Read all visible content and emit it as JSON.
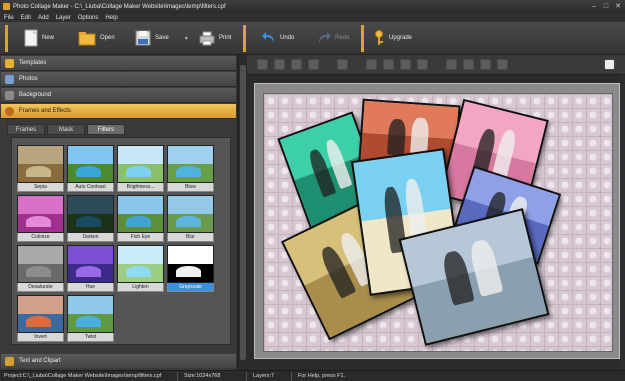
{
  "window": {
    "title": "Photo Collage Maker - C:\\_Liuba\\Collage Maker Website\\Images\\temp\\filters.cpf",
    "controls": [
      "minimize-icon",
      "maximize-icon",
      "close-icon"
    ]
  },
  "menu": [
    "File",
    "Edit",
    "Add",
    "Layer",
    "Options",
    "Help"
  ],
  "toolbar": {
    "new": "New",
    "open": "Open",
    "save": "Save",
    "print": "Print",
    "undo": "Undo",
    "redo": "Redo",
    "upgrade": "Upgrade"
  },
  "sidebar": {
    "templates": "Templates",
    "photos": "Photos",
    "background": "Background",
    "frames_effects": "Frames and Effects",
    "text_clipart": "Text and Clipart"
  },
  "tabs": [
    "Frames",
    "Mask",
    "Filters"
  ],
  "active_tab": "Filters",
  "filters": [
    {
      "label": "Sepia",
      "sky": "#b8a47e",
      "land": "#8a6b3e",
      "sea": "#c9b58a"
    },
    {
      "label": "Auto Contrast",
      "sky": "#7fc6f0",
      "land": "#4d8a2e",
      "sea": "#38a7d6"
    },
    {
      "label": "Brightness...",
      "sky": "#c7e7f8",
      "land": "#8bc06a",
      "sea": "#7dd0ee"
    },
    {
      "label": "Blow",
      "sky": "#9fd1ee",
      "land": "#6a9f4a",
      "sea": "#4fb3e0"
    },
    {
      "label": "Colorize",
      "sky": "#d870c8",
      "land": "#a02f8e",
      "sea": "#e48ad6"
    },
    {
      "label": "Darken",
      "sky": "#2d4a5a",
      "land": "#1c3318",
      "sea": "#1a4a60"
    },
    {
      "label": "Fish Eye",
      "sky": "#8cc6ea",
      "land": "#5d8e3a",
      "sea": "#3fa3d4"
    },
    {
      "label": "Blur",
      "sky": "#94c8e6",
      "land": "#6a9a4c",
      "sea": "#5db4de"
    },
    {
      "label": "Desaturate",
      "sky": "#a9a9a9",
      "land": "#6a6a6a",
      "sea": "#8c8c8c"
    },
    {
      "label": "Hue",
      "sky": "#7a4fd6",
      "land": "#3d2a8a",
      "sea": "#9a6ae6"
    },
    {
      "label": "Lighten",
      "sky": "#c9ecfb",
      "land": "#9ccd82",
      "sea": "#8fdaf3"
    },
    {
      "label": "Grayscale",
      "sky": "#ffffff",
      "land": "#000000",
      "sea": "#f0f0f0"
    },
    {
      "label": "Invert",
      "sky": "#d0a08a",
      "land": "#3a6aa0",
      "sea": "#e06a3a"
    },
    {
      "label": "Twist",
      "sky": "#8fc8e8",
      "land": "#5f9a42",
      "sea": "#4aaede"
    }
  ],
  "selected_filter": "Grayscale",
  "collage_photos": [
    {
      "tint_sky": "#3dd0a8",
      "tint_ground": "#1f8f72"
    },
    {
      "tint_sky": "#e07a5a",
      "tint_ground": "#b04a30"
    },
    {
      "tint_sky": "#f2a6c4",
      "tint_ground": "#d678a0"
    },
    {
      "tint_sky": "#8ea0e8",
      "tint_ground": "#5a6ac0"
    },
    {
      "tint_sky": "#d6c07a",
      "tint_ground": "#a88e4a"
    },
    {
      "tint_sky": "#7ad0f0",
      "tint_ground": "#f0e6c8"
    },
    {
      "tint_sky": "#b6c8d8",
      "tint_ground": "#8aa0b0"
    }
  ],
  "status": {
    "project": "Project:C:\\_Liuba\\Collage Maker Website\\Images\\temp\\filters.cpf",
    "size": "Size:1024x768",
    "layers": "Layers:7",
    "help": "For Help, press F1."
  },
  "colors": {
    "accent": "#e3a83a",
    "selected_blue": "#3b8fe0"
  }
}
